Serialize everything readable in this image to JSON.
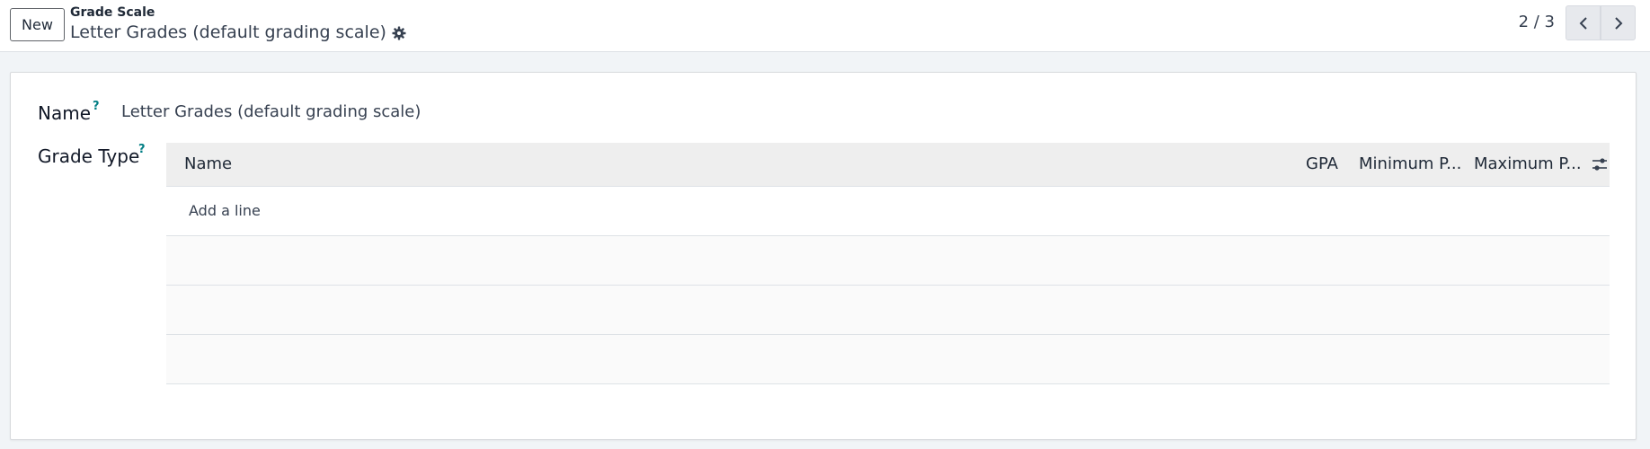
{
  "control_panel": {
    "new_label": "New",
    "breadcrumb": "Grade Scale",
    "record_title": "Letter Grades (default grading scale)",
    "pager": "2 / 3"
  },
  "form": {
    "name_label": "Name",
    "name_help": "?",
    "name_value": "Letter Grades (default grading scale)",
    "grade_type_label": "Grade Type",
    "grade_type_help": "?",
    "table": {
      "columns": [
        "Name",
        "GPA",
        "Minimum P...",
        "Maximum P..."
      ],
      "add_line_label": "Add a line",
      "empty_rows": 3
    }
  },
  "colors": {
    "accent": "#017e84",
    "header_bg": "#eeeeee",
    "page_bg": "#f1f4f7"
  },
  "icons": {
    "settings": "gear-icon",
    "previous": "chevron-left-icon",
    "next": "chevron-right-icon",
    "optional_columns": "sliders-icon"
  }
}
